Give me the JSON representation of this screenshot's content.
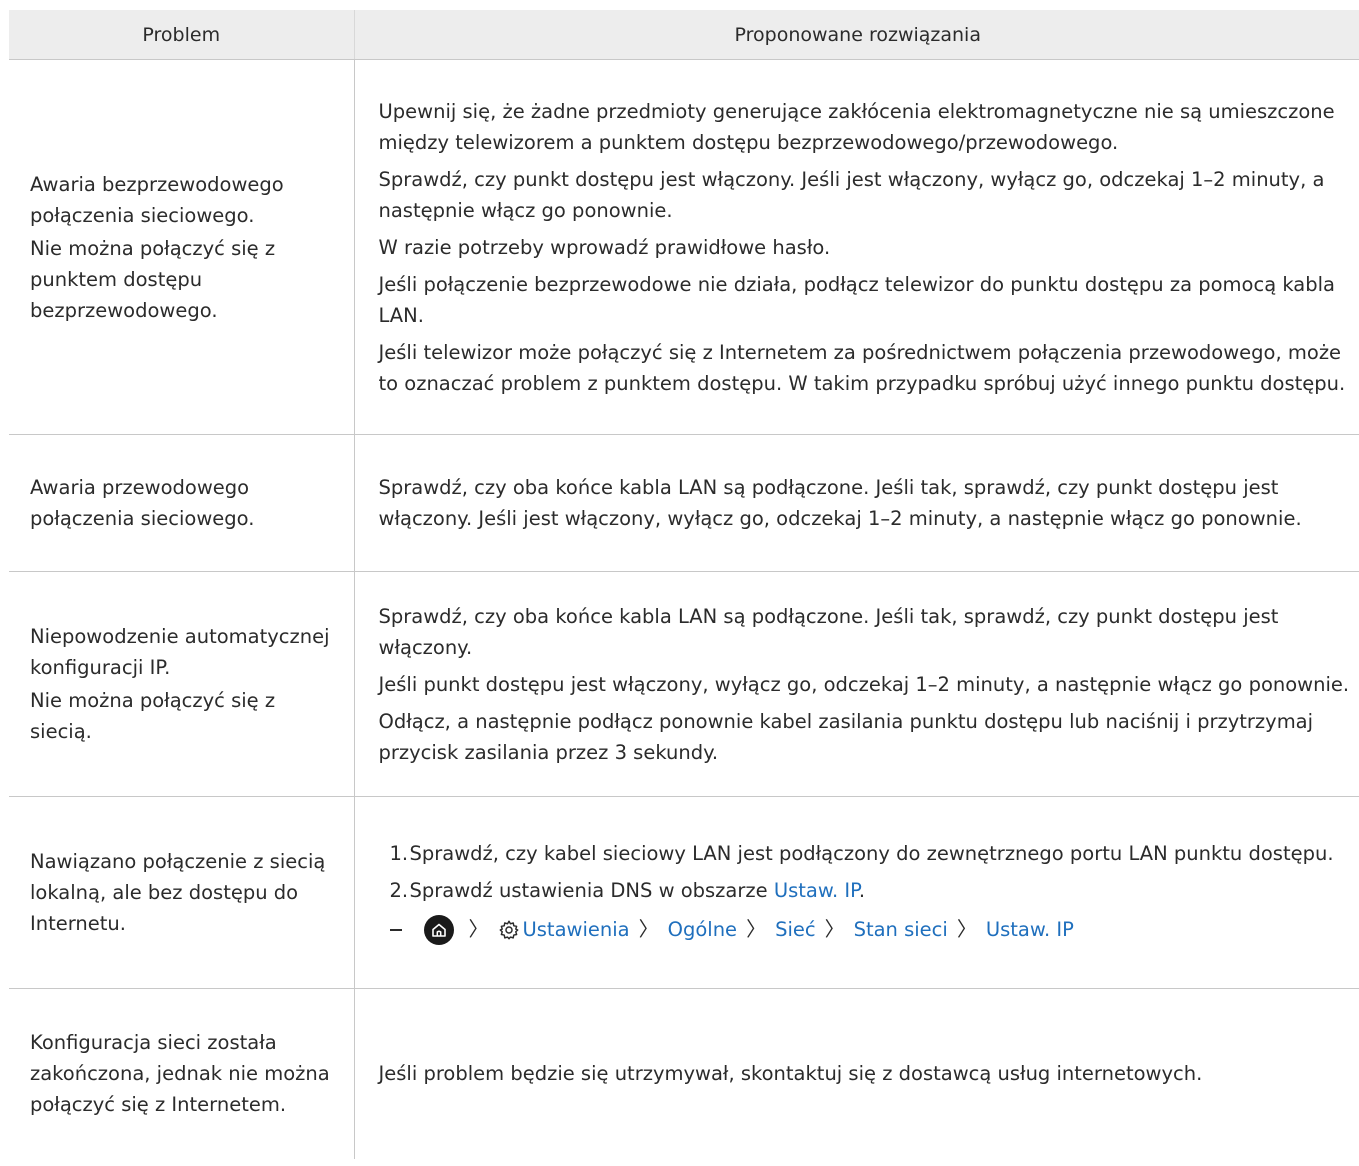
{
  "header": {
    "col1": "Problem",
    "col2": "Proponowane rozwiązania"
  },
  "rows": [
    {
      "problem": [
        "Awaria bezprzewodowego połączenia sieciowego.",
        "Nie można połączyć się z punktem dostępu bezprzewodowego."
      ],
      "solutions": [
        "Upewnij się, że żadne przedmioty generujące zakłócenia elektromagnetyczne nie są umieszczone między telewizorem a punktem dostępu bezprzewodowego/przewodowego.",
        "Sprawdź, czy punkt dostępu jest włączony. Jeśli jest włączony, wyłącz go, odczekaj 1–2 minuty, a następnie włącz go ponownie.",
        "W razie potrzeby wprowadź prawidłowe hasło.",
        "Jeśli połączenie bezprzewodowe nie działa, podłącz telewizor do punktu dostępu za pomocą kabla LAN.",
        "Jeśli telewizor może połączyć się z Internetem za pośrednictwem połączenia przewodowego, może to oznaczać problem z punktem dostępu. W takim przypadku spróbuj użyć innego punktu dostępu."
      ]
    },
    {
      "problem": [
        "Awaria przewodowego połączenia sieciowego."
      ],
      "solutions": [
        "Sprawdź, czy oba końce kabla LAN są podłączone. Jeśli tak, sprawdź, czy punkt dostępu jest włączony. Jeśli jest włączony, wyłącz go, odczekaj 1–2 minuty, a następnie włącz go ponownie."
      ]
    },
    {
      "problem": [
        "Niepowodzenie automatycznej konfiguracji IP.",
        "Nie można połączyć się z siecią."
      ],
      "solutions": [
        "Sprawdź, czy oba końce kabla LAN są podłączone. Jeśli tak, sprawdź, czy punkt dostępu jest włączony.",
        "Jeśli punkt dostępu jest włączony, wyłącz go, odczekaj 1–2 minuty, a następnie włącz go ponownie.",
        "Odłącz, a następnie podłącz ponownie kabel zasilania punktu dostępu lub naciśnij i przytrzymaj przycisk zasilania przez 3 sekundy."
      ]
    },
    {
      "problem": [
        "Nawiązano połączenie z siecią lokalną, ale bez dostępu do Internetu."
      ],
      "steps": [
        {
          "num": "1.",
          "text": "Sprawdź, czy kabel sieciowy LAN jest podłączony do zewnętrznego portu LAN punktu dostępu."
        },
        {
          "num": "2.",
          "text": "Sprawdź ustawienia DNS w obszarze ",
          "link": "Ustaw. IP",
          "after": "."
        }
      ],
      "path": {
        "home_icon": "home-icon",
        "settings_icon": "gear-icon",
        "items": [
          "Ustawienia",
          "Ogólne",
          "Sieć",
          "Stan sieci",
          "Ustaw. IP"
        ],
        "separator": "〉"
      }
    },
    {
      "problem": [
        "Konfiguracja sieci została zakończona, jednak nie można połączyć się z Internetem."
      ],
      "solutions": [
        "Jeśli problem będzie się utrzymywał, skontaktuj się z dostawcą usług internetowych."
      ]
    }
  ],
  "colors": {
    "link": "#1f6fbd",
    "header_bg": "#ededed",
    "text": "#2b2b2b"
  }
}
